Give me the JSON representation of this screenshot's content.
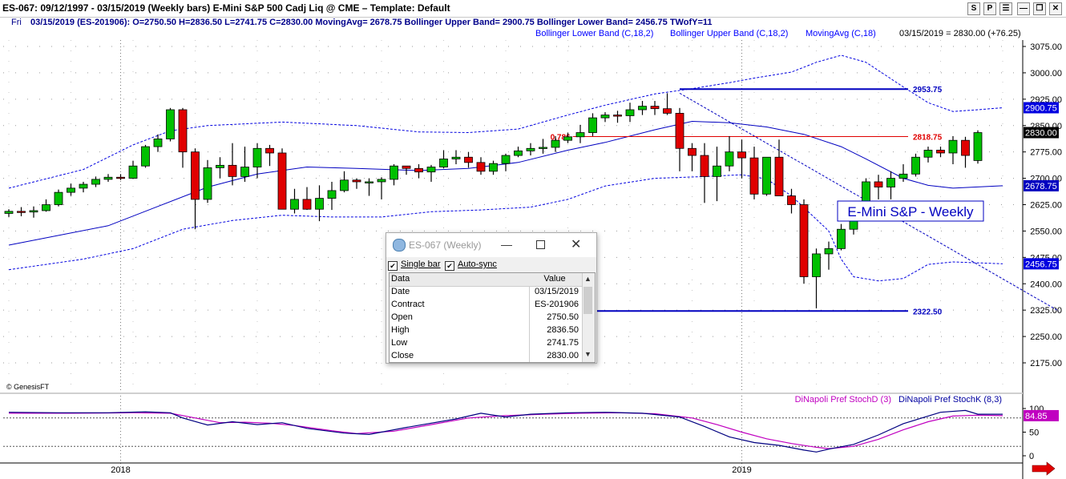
{
  "window": {
    "title": "ES-067:  09/12/1997 - 03/15/2019  (Weekly bars)   E-Mini S&P 500 Cadj Liq @ CME  –  Template: Default",
    "buttons": [
      "S",
      "P",
      "☰",
      "—",
      "❐",
      "✕"
    ]
  },
  "info_bar": {
    "day": "Fri",
    "text": "03/15/2019 (ES-201906):  O=2750.50  H=2836.50  L=2741.75  C=2830.00  MovingAvg= 2678.75  Bollinger Upper Band= 2900.75  Bollinger Lower Band= 2456.75  TWofY=11"
  },
  "indicators_line": {
    "lower": "Bollinger Lower Band (C,18,2)",
    "upper": "Bollinger Upper Band (C,18,2)",
    "ma": "MovingAvg (C,18)",
    "last": "03/15/2019 = 2830.00 (+76.25)"
  },
  "chart_data": {
    "type": "candlestick",
    "title": "E-Mini S&P - Weekly",
    "watermark": "© GenesisFT",
    "y_axis": {
      "min": 2100,
      "max": 3100,
      "ticks": [
        "3075.00",
        "3000.00",
        "2925.00",
        "2850.00",
        "2775.00",
        "2700.00",
        "2625.00",
        "2550.00",
        "2475.00",
        "2400.00",
        "2325.00",
        "2250.00",
        "2175.00"
      ],
      "tick_values": [
        3075,
        3000,
        2925,
        2850,
        2775,
        2700,
        2625,
        2550,
        2475,
        2400,
        2325,
        2250,
        2175
      ]
    },
    "x_axis": {
      "labels": [
        "2018",
        "2019"
      ],
      "label_bars": [
        9,
        59
      ]
    },
    "colors": {
      "up": "#00c000",
      "down": "#e00000",
      "ma": "#0000c0",
      "band": "#0000e0",
      "level": "#0000c0",
      "fib": "#e00000",
      "stochD": "#c000c0",
      "stochK": "#000080"
    },
    "bars": [
      [
        2600,
        2612,
        2590,
        2606
      ],
      [
        2606,
        2618,
        2592,
        2604
      ],
      [
        2604,
        2620,
        2588,
        2608
      ],
      [
        2608,
        2640,
        2605,
        2625
      ],
      [
        2625,
        2668,
        2620,
        2660
      ],
      [
        2660,
        2685,
        2650,
        2672
      ],
      [
        2672,
        2690,
        2660,
        2683
      ],
      [
        2683,
        2705,
        2675,
        2697
      ],
      [
        2697,
        2712,
        2690,
        2703
      ],
      [
        2703,
        2712,
        2695,
        2700
      ],
      [
        2700,
        2750,
        2698,
        2735
      ],
      [
        2735,
        2795,
        2730,
        2790
      ],
      [
        2790,
        2825,
        2775,
        2812
      ],
      [
        2812,
        2900,
        2805,
        2895
      ],
      [
        2895,
        2900,
        2730,
        2775
      ],
      [
        2775,
        2785,
        2555,
        2640
      ],
      [
        2640,
        2752,
        2630,
        2730
      ],
      [
        2730,
        2760,
        2700,
        2737
      ],
      [
        2737,
        2800,
        2680,
        2705
      ],
      [
        2705,
        2790,
        2690,
        2732
      ],
      [
        2732,
        2800,
        2700,
        2785
      ],
      [
        2785,
        2795,
        2735,
        2772
      ],
      [
        2772,
        2785,
        2620,
        2612
      ],
      [
        2612,
        2670,
        2600,
        2640
      ],
      [
        2640,
        2675,
        2610,
        2612
      ],
      [
        2612,
        2680,
        2578,
        2643
      ],
      [
        2643,
        2690,
        2610,
        2665
      ],
      [
        2665,
        2720,
        2660,
        2695
      ],
      [
        2695,
        2700,
        2670,
        2690
      ],
      [
        2690,
        2700,
        2650,
        2690
      ],
      [
        2690,
        2703,
        2640,
        2697
      ],
      [
        2697,
        2740,
        2680,
        2735
      ],
      [
        2735,
        2735,
        2710,
        2728
      ],
      [
        2728,
        2740,
        2700,
        2718
      ],
      [
        2718,
        2738,
        2690,
        2732
      ],
      [
        2732,
        2780,
        2728,
        2755
      ],
      [
        2755,
        2780,
        2740,
        2760
      ],
      [
        2760,
        2775,
        2730,
        2745
      ],
      [
        2745,
        2760,
        2710,
        2720
      ],
      [
        2720,
        2750,
        2710,
        2742
      ],
      [
        2742,
        2770,
        2720,
        2765
      ],
      [
        2765,
        2790,
        2760,
        2778
      ],
      [
        2778,
        2800,
        2765,
        2785
      ],
      [
        2785,
        2812,
        2770,
        2788
      ],
      [
        2788,
        2820,
        2775,
        2808
      ],
      [
        2808,
        2830,
        2800,
        2818
      ],
      [
        2818,
        2852,
        2800,
        2830
      ],
      [
        2830,
        2885,
        2820,
        2872
      ],
      [
        2872,
        2888,
        2860,
        2880
      ],
      [
        2880,
        2892,
        2858,
        2878
      ],
      [
        2878,
        2915,
        2860,
        2895
      ],
      [
        2895,
        2920,
        2880,
        2905
      ],
      [
        2905,
        2920,
        2880,
        2898
      ],
      [
        2898,
        2942,
        2880,
        2885
      ],
      [
        2885,
        2900,
        2720,
        2785
      ],
      [
        2785,
        2800,
        2720,
        2765
      ],
      [
        2765,
        2800,
        2630,
        2705
      ],
      [
        2705,
        2790,
        2635,
        2735
      ],
      [
        2735,
        2820,
        2720,
        2775
      ],
      [
        2775,
        2810,
        2700,
        2758
      ],
      [
        2758,
        2790,
        2640,
        2655
      ],
      [
        2655,
        2760,
        2650,
        2760
      ],
      [
        2760,
        2810,
        2650,
        2650
      ],
      [
        2650,
        2670,
        2600,
        2625
      ],
      [
        2625,
        2640,
        2400,
        2420
      ],
      [
        2420,
        2500,
        2330,
        2485
      ],
      [
        2485,
        2520,
        2440,
        2500
      ],
      [
        2500,
        2570,
        2495,
        2555
      ],
      [
        2555,
        2610,
        2540,
        2600
      ],
      [
        2600,
        2700,
        2590,
        2690
      ],
      [
        2690,
        2710,
        2640,
        2675
      ],
      [
        2675,
        2720,
        2640,
        2700
      ],
      [
        2700,
        2740,
        2690,
        2712
      ],
      [
        2712,
        2770,
        2705,
        2760
      ],
      [
        2760,
        2790,
        2745,
        2780
      ],
      [
        2780,
        2790,
        2760,
        2772
      ],
      [
        2772,
        2820,
        2740,
        2808
      ],
      [
        2808,
        2818,
        2730,
        2765
      ],
      [
        2750.5,
        2836.5,
        2741.75,
        2830
      ]
    ],
    "moving_avg": [
      [
        0,
        2510
      ],
      [
        8,
        2565
      ],
      [
        12,
        2620
      ],
      [
        16,
        2675
      ],
      [
        20,
        2712
      ],
      [
        24,
        2732
      ],
      [
        28,
        2728
      ],
      [
        33,
        2722
      ],
      [
        37,
        2728
      ],
      [
        41,
        2745
      ],
      [
        45,
        2780
      ],
      [
        48,
        2802
      ],
      [
        52,
        2838
      ],
      [
        55,
        2862
      ],
      [
        58,
        2858
      ],
      [
        61,
        2846
      ],
      [
        64,
        2825
      ],
      [
        67,
        2790
      ],
      [
        69,
        2755
      ],
      [
        72,
        2700
      ],
      [
        74,
        2680
      ],
      [
        76,
        2672
      ],
      [
        80,
        2678.75
      ]
    ],
    "upper_band": [
      [
        0,
        2672
      ],
      [
        6,
        2725
      ],
      [
        10,
        2795
      ],
      [
        13,
        2835
      ],
      [
        16,
        2850
      ],
      [
        22,
        2860
      ],
      [
        28,
        2850
      ],
      [
        33,
        2832
      ],
      [
        37,
        2830
      ],
      [
        41,
        2840
      ],
      [
        45,
        2880
      ],
      [
        48,
        2908
      ],
      [
        52,
        2940
      ],
      [
        55,
        2955
      ],
      [
        58,
        2972
      ],
      [
        60,
        2985
      ],
      [
        63,
        3002
      ],
      [
        65,
        3030
      ],
      [
        67,
        3050
      ],
      [
        69,
        3030
      ],
      [
        72,
        2960
      ],
      [
        74,
        2915
      ],
      [
        76,
        2890
      ],
      [
        78,
        2895
      ],
      [
        80,
        2900.75
      ]
    ],
    "lower_band": [
      [
        0,
        2440
      ],
      [
        6,
        2470
      ],
      [
        10,
        2500
      ],
      [
        14,
        2555
      ],
      [
        18,
        2580
      ],
      [
        22,
        2595
      ],
      [
        26,
        2590
      ],
      [
        30,
        2590
      ],
      [
        34,
        2605
      ],
      [
        38,
        2610
      ],
      [
        42,
        2618
      ],
      [
        45,
        2640
      ],
      [
        48,
        2678
      ],
      [
        52,
        2700
      ],
      [
        56,
        2705
      ],
      [
        59,
        2710
      ],
      [
        61,
        2698
      ],
      [
        63,
        2650
      ],
      [
        66,
        2550
      ],
      [
        67,
        2470
      ],
      [
        68,
        2420
      ],
      [
        70,
        2408
      ],
      [
        72,
        2415
      ],
      [
        74,
        2455
      ],
      [
        76,
        2462
      ],
      [
        80,
        2456.75
      ]
    ],
    "levels": [
      {
        "value": 2953.75,
        "label": "2953.75",
        "from_bar": 54
      },
      {
        "value": 2818.75,
        "label": "2818.75",
        "from_bar": 0,
        "fib_label": "0.786"
      },
      {
        "value": 2322.5,
        "label": "2322.50",
        "from_bar": 44
      }
    ],
    "trendline": {
      "from_bar": 54,
      "from_value": 2942,
      "to_bar": 84.5,
      "to_value": 2322.5
    },
    "price_tags": [
      {
        "value": 2900.75,
        "label": "2900.75",
        "style": "band"
      },
      {
        "value": 2830.0,
        "label": "2830.00",
        "style": "last"
      },
      {
        "value": 2678.75,
        "label": "2678.75",
        "style": "ma"
      },
      {
        "value": 2456.75,
        "label": "2456.75",
        "style": "band"
      }
    ],
    "oscillator": {
      "legend_d": "DiNapoli Pref StochD (3)",
      "legend_k": "DiNapoli Pref StochK (8,3)",
      "ticks": [
        "100",
        "50",
        "0"
      ],
      "tick_values": [
        100,
        50,
        0
      ],
      "ref_lines": [
        80,
        20
      ],
      "last_tag": "84.85",
      "stochK": [
        [
          0,
          92
        ],
        [
          4,
          91
        ],
        [
          8,
          91
        ],
        [
          11,
          93
        ],
        [
          13,
          91
        ],
        [
          14,
          80
        ],
        [
          16,
          65
        ],
        [
          18,
          72
        ],
        [
          20,
          66
        ],
        [
          22,
          70
        ],
        [
          24,
          58
        ],
        [
          27,
          48
        ],
        [
          29,
          45
        ],
        [
          32,
          60
        ],
        [
          36,
          78
        ],
        [
          38,
          90
        ],
        [
          40,
          82
        ],
        [
          42,
          88
        ],
        [
          45,
          91
        ],
        [
          48,
          92
        ],
        [
          51,
          90
        ],
        [
          54,
          82
        ],
        [
          56,
          62
        ],
        [
          58,
          40
        ],
        [
          60,
          28
        ],
        [
          62,
          22
        ],
        [
          64,
          12
        ],
        [
          65,
          8
        ],
        [
          66,
          14
        ],
        [
          68,
          24
        ],
        [
          70,
          44
        ],
        [
          72,
          68
        ],
        [
          75,
          92
        ],
        [
          77,
          96
        ],
        [
          78,
          88
        ],
        [
          80,
          88
        ]
      ],
      "stochD": [
        [
          0,
          90
        ],
        [
          5,
          90
        ],
        [
          10,
          91
        ],
        [
          13,
          90
        ],
        [
          15,
          80
        ],
        [
          17,
          70
        ],
        [
          19,
          71
        ],
        [
          21,
          69
        ],
        [
          23,
          64
        ],
        [
          26,
          53
        ],
        [
          28,
          47
        ],
        [
          31,
          52
        ],
        [
          34,
          66
        ],
        [
          37,
          80
        ],
        [
          40,
          85
        ],
        [
          43,
          88
        ],
        [
          46,
          90
        ],
        [
          49,
          91
        ],
        [
          52,
          89
        ],
        [
          55,
          80
        ],
        [
          57,
          66
        ],
        [
          59,
          50
        ],
        [
          61,
          36
        ],
        [
          63,
          26
        ],
        [
          65,
          18
        ],
        [
          66,
          15
        ],
        [
          68,
          20
        ],
        [
          70,
          35
        ],
        [
          72,
          55
        ],
        [
          74,
          72
        ],
        [
          76,
          84
        ],
        [
          78,
          86
        ],
        [
          80,
          84.85
        ]
      ]
    }
  },
  "popup": {
    "title": "ES-067 (Weekly)",
    "single_bar": "Single bar",
    "auto_sync": "Auto-sync",
    "col_data": "Data",
    "col_value": "Value",
    "rows": [
      {
        "label": "Date",
        "value": "03/15/2019"
      },
      {
        "label": "Contract",
        "value": "ES-201906"
      },
      {
        "label": "Open",
        "value": "2750.50"
      },
      {
        "label": "High",
        "value": "2836.50"
      },
      {
        "label": "Low",
        "value": "2741.75"
      },
      {
        "label": "Close",
        "value": "2830.00"
      }
    ]
  }
}
